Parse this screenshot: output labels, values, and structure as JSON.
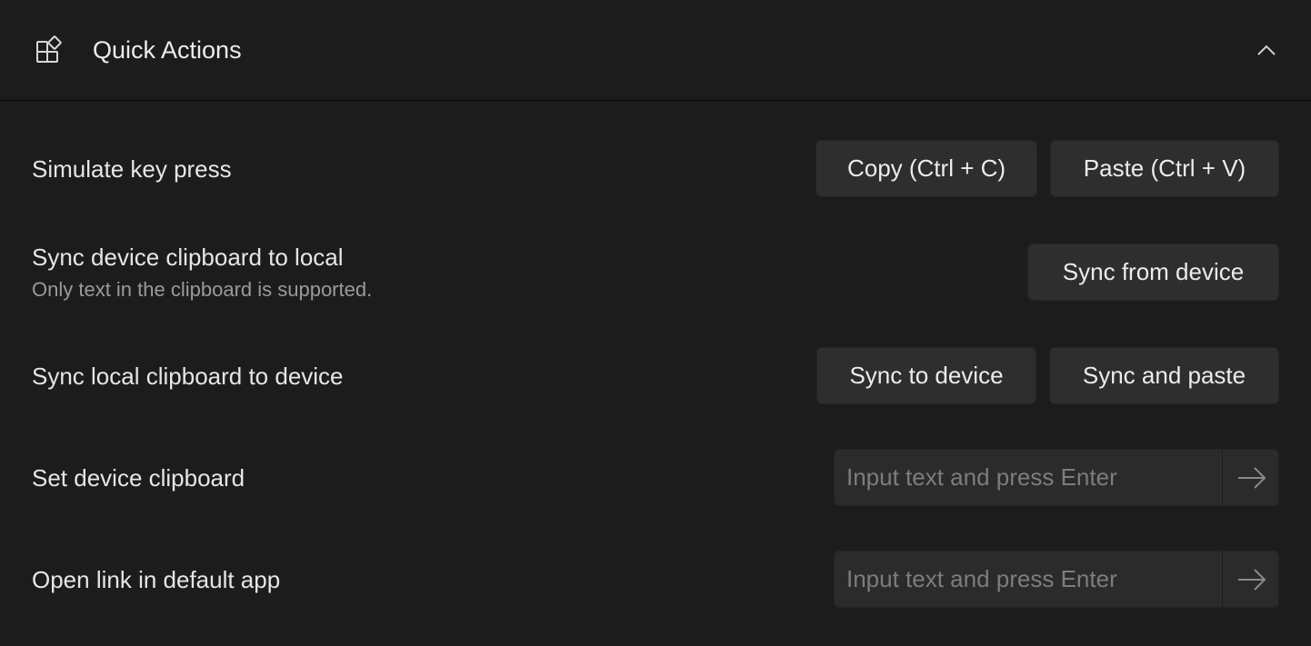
{
  "header": {
    "title": "Quick Actions",
    "icon": "add-widget-icon",
    "collapse_icon": "chevron-up-icon"
  },
  "rows": [
    {
      "label": "Simulate key press",
      "buttons": [
        "Copy (Ctrl + C)",
        "Paste (Ctrl + V)"
      ]
    },
    {
      "label": "Sync device clipboard to local",
      "sub": "Only text in the clipboard is supported.",
      "buttons": [
        "Sync from device"
      ]
    },
    {
      "label": "Sync local clipboard to device",
      "buttons": [
        "Sync to device",
        "Sync and paste"
      ]
    },
    {
      "label": "Set device clipboard",
      "input_placeholder": "Input text and press Enter",
      "submit_icon": "arrow-right-icon"
    },
    {
      "label": "Open link in default app",
      "input_placeholder": "Input text and press Enter",
      "submit_icon": "arrow-right-icon"
    }
  ],
  "colors": {
    "background": "#1c1c1c",
    "button": "#2e2e2e",
    "input": "#2b2b2b",
    "text": "#e6e6e6",
    "muted": "#9a9a9a"
  }
}
